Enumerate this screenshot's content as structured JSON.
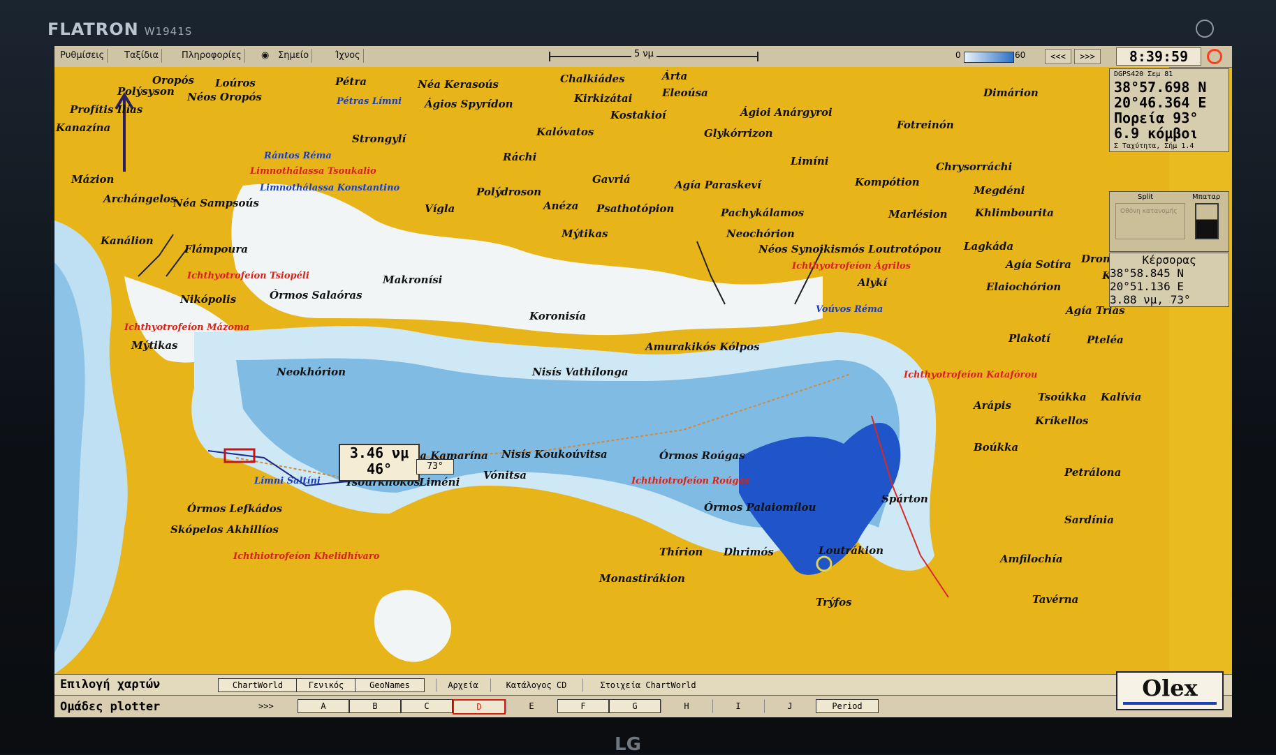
{
  "monitor": {
    "brand": "FLATRON",
    "model": "W1941S",
    "maker": "LG"
  },
  "topbar": {
    "menu": [
      "Ρυθμίσεις",
      "Ταξίδια",
      "Πληροφορίες",
      "Σημείο",
      "Ίχνος"
    ],
    "scale": "5 νμ",
    "depth_min": "0",
    "depth_max": "60",
    "nav_prev": "<<<",
    "nav_next": ">>>",
    "clock": "8:39:59"
  },
  "info": {
    "gps_line": "DGPS420 Σεμ 81",
    "lat": "38°57.698 N",
    "lon": "20°46.364 E",
    "heading": "Πορεία 93°",
    "speed": "6.9 κόμβοι",
    "note": "Σ Ταχύτητα, Σήμ 1.4",
    "split_label": "Split",
    "battery_label": "Μπαταρ",
    "split_hint": "Οθόνη κατανομής",
    "cursor_label": "Κέρσορας",
    "cursor_lat": "38°58.845 N",
    "cursor_lon": "20°51.136 E",
    "cursor_range": "3.88 νμ, 73°"
  },
  "overlay": {
    "speed_line1": "3.46 νμ",
    "speed_line2": "46°",
    "bearing": "73°"
  },
  "places": [
    {
      "t": "Oropós",
      "c": "black"
    },
    {
      "t": "Loúros",
      "c": "black"
    },
    {
      "t": "Polýsyson",
      "c": "black"
    },
    {
      "t": "Néos Oropós",
      "c": "black"
    },
    {
      "t": "Profítis Ilías",
      "c": "black"
    },
    {
      "t": "Kanazína",
      "c": "black"
    },
    {
      "t": "Mázion",
      "c": "black"
    },
    {
      "t": "Archángelos",
      "c": "black"
    },
    {
      "t": "Néa Sampsoús",
      "c": "black"
    },
    {
      "t": "Kanálion",
      "c": "black"
    },
    {
      "t": "Flámpoura",
      "c": "black"
    },
    {
      "t": "Pétra",
      "c": "black"
    },
    {
      "t": "Néa Kerasoús",
      "c": "black"
    },
    {
      "t": "Pétras Límni",
      "c": "blue"
    },
    {
      "t": "Ágios Spyrídon",
      "c": "black"
    },
    {
      "t": "Chalkiádes",
      "c": "black"
    },
    {
      "t": "Árta",
      "c": "black"
    },
    {
      "t": "Kirkizátai",
      "c": "black"
    },
    {
      "t": "Eleoúsa",
      "c": "black"
    },
    {
      "t": "Kostakioí",
      "c": "black"
    },
    {
      "t": "Ágioi Anárgyroi",
      "c": "black"
    },
    {
      "t": "Dimárion",
      "c": "black"
    },
    {
      "t": "Fotreinón",
      "c": "black"
    },
    {
      "t": "Strongylí",
      "c": "black"
    },
    {
      "t": "Kalóvatos",
      "c": "black"
    },
    {
      "t": "Glykórrizon",
      "c": "black"
    },
    {
      "t": "Ráchi",
      "c": "black"
    },
    {
      "t": "Limíni",
      "c": "black"
    },
    {
      "t": "Chrysorráchi",
      "c": "black"
    },
    {
      "t": "Rántos Réma",
      "c": "blue"
    },
    {
      "t": "Limnothálassa Tsoukalio",
      "c": "red"
    },
    {
      "t": "Limnothálassa Konstantino",
      "c": "blue"
    },
    {
      "t": "Gavriá",
      "c": "black"
    },
    {
      "t": "Agía Paraskeví",
      "c": "black"
    },
    {
      "t": "Kompótion",
      "c": "black"
    },
    {
      "t": "Megdéni",
      "c": "black"
    },
    {
      "t": "Polýdroson",
      "c": "black"
    },
    {
      "t": "Vígla",
      "c": "black"
    },
    {
      "t": "Anéza",
      "c": "black"
    },
    {
      "t": "Psathotópion",
      "c": "black"
    },
    {
      "t": "Pachykálamos",
      "c": "black"
    },
    {
      "t": "Marlésion",
      "c": "black"
    },
    {
      "t": "Khlimbourita",
      "c": "black"
    },
    {
      "t": "Mýtikas",
      "c": "black"
    },
    {
      "t": "Neochórion",
      "c": "black"
    },
    {
      "t": "Néos Synoikismós Loutrotópou",
      "c": "black"
    },
    {
      "t": "Lagkáda",
      "c": "black"
    },
    {
      "t": "Agía Sotíra",
      "c": "black"
    },
    {
      "t": "Dromítsa",
      "c": "black"
    },
    {
      "t": "Kechrí",
      "c": "black"
    },
    {
      "t": "Ichthyotrofeíon Tsiopéli",
      "c": "red"
    },
    {
      "t": "Makronísi",
      "c": "black"
    },
    {
      "t": "Ichthyotrofeíon Ágrilos",
      "c": "red"
    },
    {
      "t": "Alykí",
      "c": "black"
    },
    {
      "t": "Elaiochórion",
      "c": "black"
    },
    {
      "t": "Nikópolis",
      "c": "black"
    },
    {
      "t": "Órmos Salaóras",
      "c": "black"
    },
    {
      "t": "Koronisía",
      "c": "black"
    },
    {
      "t": "Voúvos Réma",
      "c": "blue"
    },
    {
      "t": "Agía Triás",
      "c": "black"
    },
    {
      "t": "Ichthyotrofeíon Mázoma",
      "c": "red"
    },
    {
      "t": "Mýtikas",
      "c": "black"
    },
    {
      "t": "Plakotí",
      "c": "black"
    },
    {
      "t": "Pteléa",
      "c": "black"
    },
    {
      "t": "Neokhórion",
      "c": "black"
    },
    {
      "t": "Amurakikós Kólpos",
      "c": "black"
    },
    {
      "t": "Nisís Vathílonga",
      "c": "black"
    },
    {
      "t": "Ichthyotrofeíon Katafórou",
      "c": "red"
    },
    {
      "t": "Tsoúkka",
      "c": "black"
    },
    {
      "t": "Kalívia",
      "c": "black"
    },
    {
      "t": "Arápis",
      "c": "black"
    },
    {
      "t": "Kríkellos",
      "c": "black"
    },
    {
      "t": "Néa Kamarína",
      "c": "black"
    },
    {
      "t": "Nisís Koukoúvitsa",
      "c": "black"
    },
    {
      "t": "Boúkka",
      "c": "black"
    },
    {
      "t": "Órmos Roúgas",
      "c": "black"
    },
    {
      "t": "Petrálona",
      "c": "black"
    },
    {
      "t": "Límni Saltíni",
      "c": "blue"
    },
    {
      "t": "Tsourkhókos",
      "c": "black"
    },
    {
      "t": "Liméni",
      "c": "black"
    },
    {
      "t": "Vónitsa",
      "c": "black"
    },
    {
      "t": "Ichthiotrofeíon Roúgas",
      "c": "red"
    },
    {
      "t": "Spárton",
      "c": "black"
    },
    {
      "t": "Órmos Lefkádos",
      "c": "black"
    },
    {
      "t": "Órmos Palaiomílou",
      "c": "black"
    },
    {
      "t": "Sardínia",
      "c": "black"
    },
    {
      "t": "Skópelos Akhillíos",
      "c": "black"
    },
    {
      "t": "Ichthiotrofeíon Khelidhívaro",
      "c": "red"
    },
    {
      "t": "Thírion",
      "c": "black"
    },
    {
      "t": "Dhrimós",
      "c": "black"
    },
    {
      "t": "Loutrákion",
      "c": "black"
    },
    {
      "t": "Amfilochía",
      "c": "black"
    },
    {
      "t": "Monastirákion",
      "c": "black"
    },
    {
      "t": "Trýfos",
      "c": "black"
    },
    {
      "t": "Tavérna",
      "c": "black"
    }
  ],
  "bottom": {
    "row1_title": "Επιλογή χαρτών",
    "row1_chips": [
      "ChartWorld",
      "Γενικός",
      "GeoNames",
      "Αρχεία",
      "Κατάλογος CD",
      "Στοιχεία ChartWorld"
    ],
    "row2_title": "Ομάδες plotter",
    "row2_arrows": ">>>",
    "groups": [
      "A",
      "B",
      "C",
      "D",
      "E",
      "F",
      "G",
      "H",
      "I",
      "J",
      "Period"
    ],
    "selected_group": "D"
  },
  "logo": "Olex"
}
